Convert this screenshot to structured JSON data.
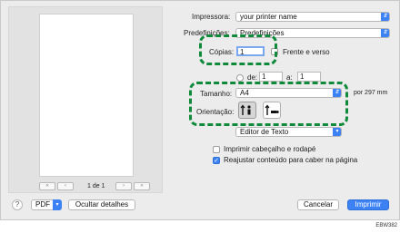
{
  "preview": {
    "first_label": "«",
    "prev_label": "‹",
    "page_counter": "1 de 1",
    "next_label": "›",
    "last_label": "»"
  },
  "settings": {
    "printer_label": "Impressora:",
    "printer_value": "your printer name",
    "preset_label": "Predefinições:",
    "preset_value": "Predefinições",
    "copies_label": "Cópias:",
    "copies_value": "1",
    "duplex_label": "Frente e verso",
    "pages_from_label": "de:",
    "pages_from_value": "1",
    "pages_to_label": "a:",
    "pages_to_value": "1",
    "size_label": "Tamanho:",
    "size_value": "A4",
    "size_dims": "por 297 mm",
    "orientation_label": "Orientação:",
    "app_menu_value": "Editor de Texto",
    "print_header_label": "Imprimir cabeçalho e rodapé",
    "print_header_checked": false,
    "rewrap_label": "Reajustar conteúdo para caber na página",
    "rewrap_checked": true
  },
  "footer": {
    "help_label": "?",
    "pdf_label": "PDF",
    "hide_details_label": "Ocultar detalhes",
    "cancel_label": "Cancelar",
    "print_label": "Imprimir"
  },
  "caption": "EBW382",
  "colors": {
    "accent_blue": "#3c82f5",
    "highlight_green": "#0f8a3a"
  }
}
